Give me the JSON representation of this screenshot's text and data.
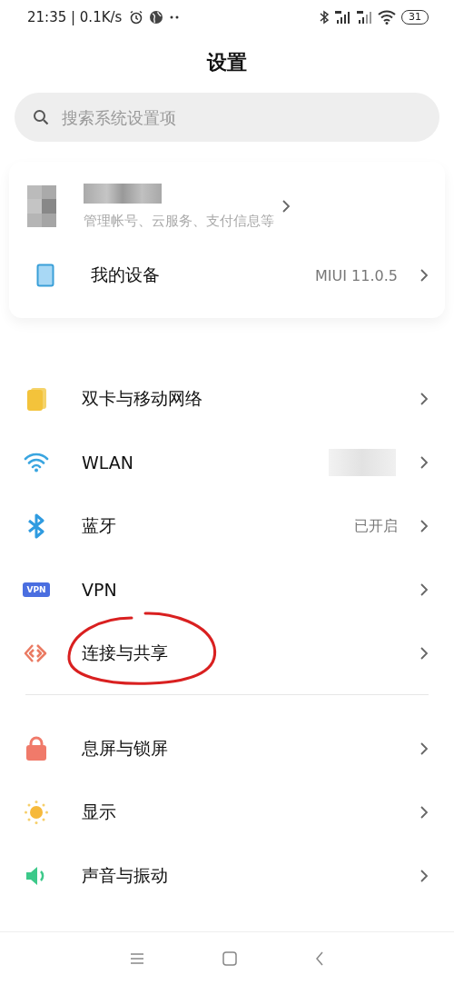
{
  "status_bar": {
    "time": "21:35 | 0.1K/s",
    "battery": "31"
  },
  "title": "设置",
  "search": {
    "placeholder": "搜索系统设置项"
  },
  "account": {
    "subtitle": "管理帐号、云服务、支付信息等"
  },
  "groups": [
    {
      "items": [
        {
          "kind": "device",
          "label": "我的设备",
          "value": "MIUI 11.0.5"
        }
      ]
    },
    {
      "items": [
        {
          "kind": "sim",
          "label": "双卡与移动网络"
        },
        {
          "kind": "wifi",
          "label": "WLAN",
          "redacted": true
        },
        {
          "kind": "bluetooth",
          "label": "蓝牙",
          "value": "已开启"
        },
        {
          "kind": "vpn",
          "label": "VPN",
          "badge": "VPN"
        },
        {
          "kind": "share",
          "label": "连接与共享",
          "circled": true
        }
      ]
    },
    {
      "items": [
        {
          "kind": "lock",
          "label": "息屏与锁屏"
        },
        {
          "kind": "sun",
          "label": "显示"
        },
        {
          "kind": "sound",
          "label": "声音与振动"
        }
      ]
    }
  ]
}
